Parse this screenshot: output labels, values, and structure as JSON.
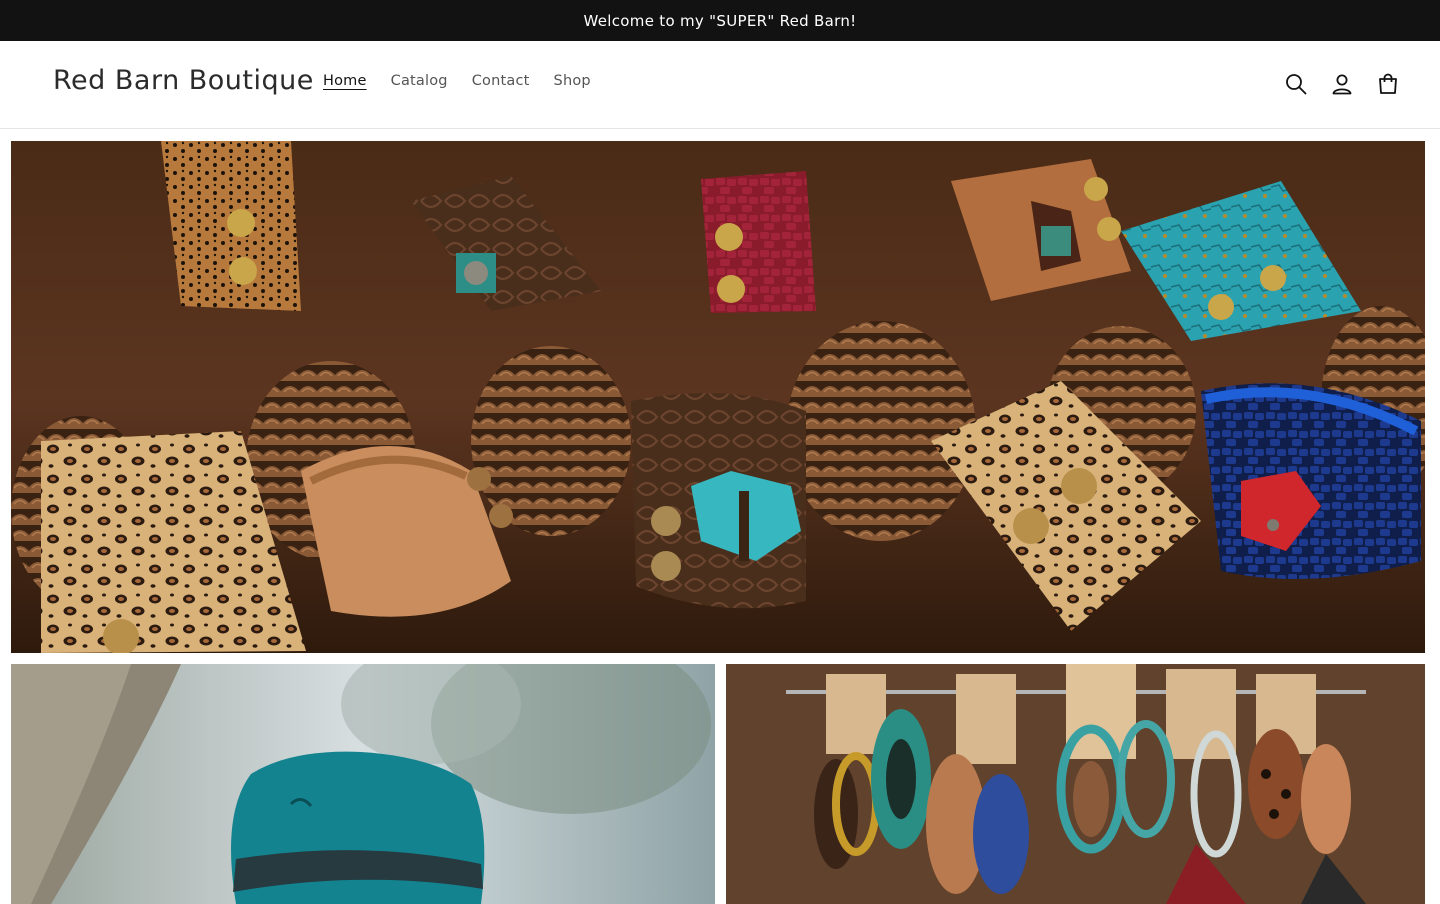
{
  "announcement": {
    "text": "Welcome to my \"SUPER\" Red Barn!"
  },
  "header": {
    "logo": "Red Barn Boutique",
    "nav": [
      {
        "label": "Home",
        "active": true
      },
      {
        "label": "Catalog",
        "active": false
      },
      {
        "label": "Contact",
        "active": false
      },
      {
        "label": "Shop",
        "active": false
      }
    ],
    "icons": [
      "search-icon",
      "account-icon",
      "cart-icon"
    ]
  },
  "colors": {
    "announcement_bg": "#121212",
    "text": "#121212",
    "nav_muted": "#555555",
    "divider": "#e4e4e4"
  }
}
